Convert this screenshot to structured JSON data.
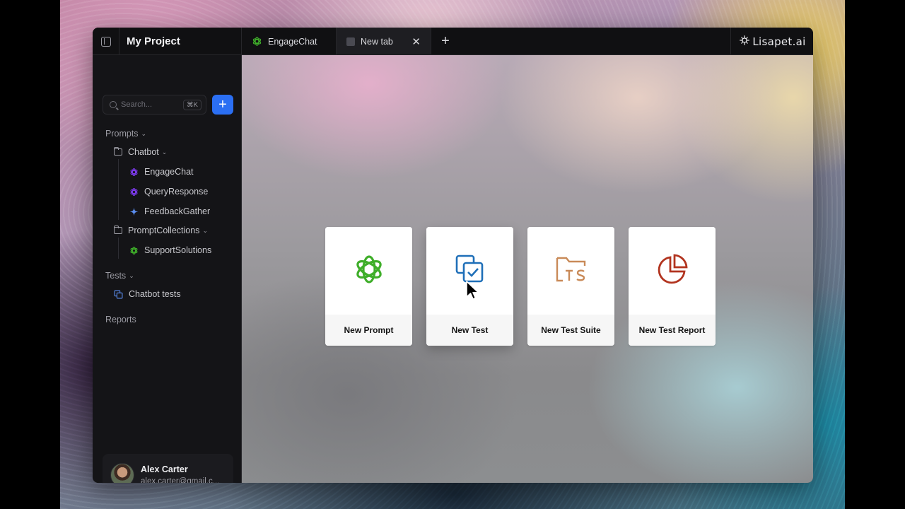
{
  "window": {
    "project_title": "My Project",
    "brand": "Lisapet.ai"
  },
  "tabs": [
    {
      "label": "EngageChat",
      "icon": "openai-icon",
      "active": false
    },
    {
      "label": "New tab",
      "icon": "blank-tab-icon",
      "active": true,
      "close": "✕"
    }
  ],
  "add_tab_label": "+",
  "sidebar": {
    "search": {
      "placeholder": "Search...",
      "shortcut": "⌘K"
    },
    "add_button": "+",
    "sections": {
      "prompts": "Prompts",
      "tests": "Tests",
      "reports": "Reports"
    },
    "chevron": "⌄",
    "folders": {
      "chatbot": "Chatbot",
      "prompt_collections": "PromptCollections"
    },
    "items": {
      "engage_chat": "EngageChat",
      "query_response": "QueryResponse",
      "feedback_gather": "FeedbackGather",
      "support_solutions": "SupportSolutions",
      "chatbot_tests": "Chatbot tests"
    },
    "user": {
      "name": "Alex Carter",
      "email": "alex.carter@gmail.c..."
    }
  },
  "cards": [
    {
      "label": "New Prompt",
      "icon": "openai-icon",
      "color": "#3fae2a"
    },
    {
      "label": "New Test",
      "icon": "test-check-icon",
      "color": "#1f6fb8"
    },
    {
      "label": "New Test Suite",
      "icon": "folder-ts-icon",
      "color": "#c98a58"
    },
    {
      "label": "New Test Report",
      "icon": "pie-chart-icon",
      "color": "#b2341f"
    }
  ],
  "colors": {
    "accent": "#2b6ff3",
    "openai_green": "#3fae2a",
    "purple": "#7c3aed",
    "gemini_blue": "#5b8def"
  }
}
